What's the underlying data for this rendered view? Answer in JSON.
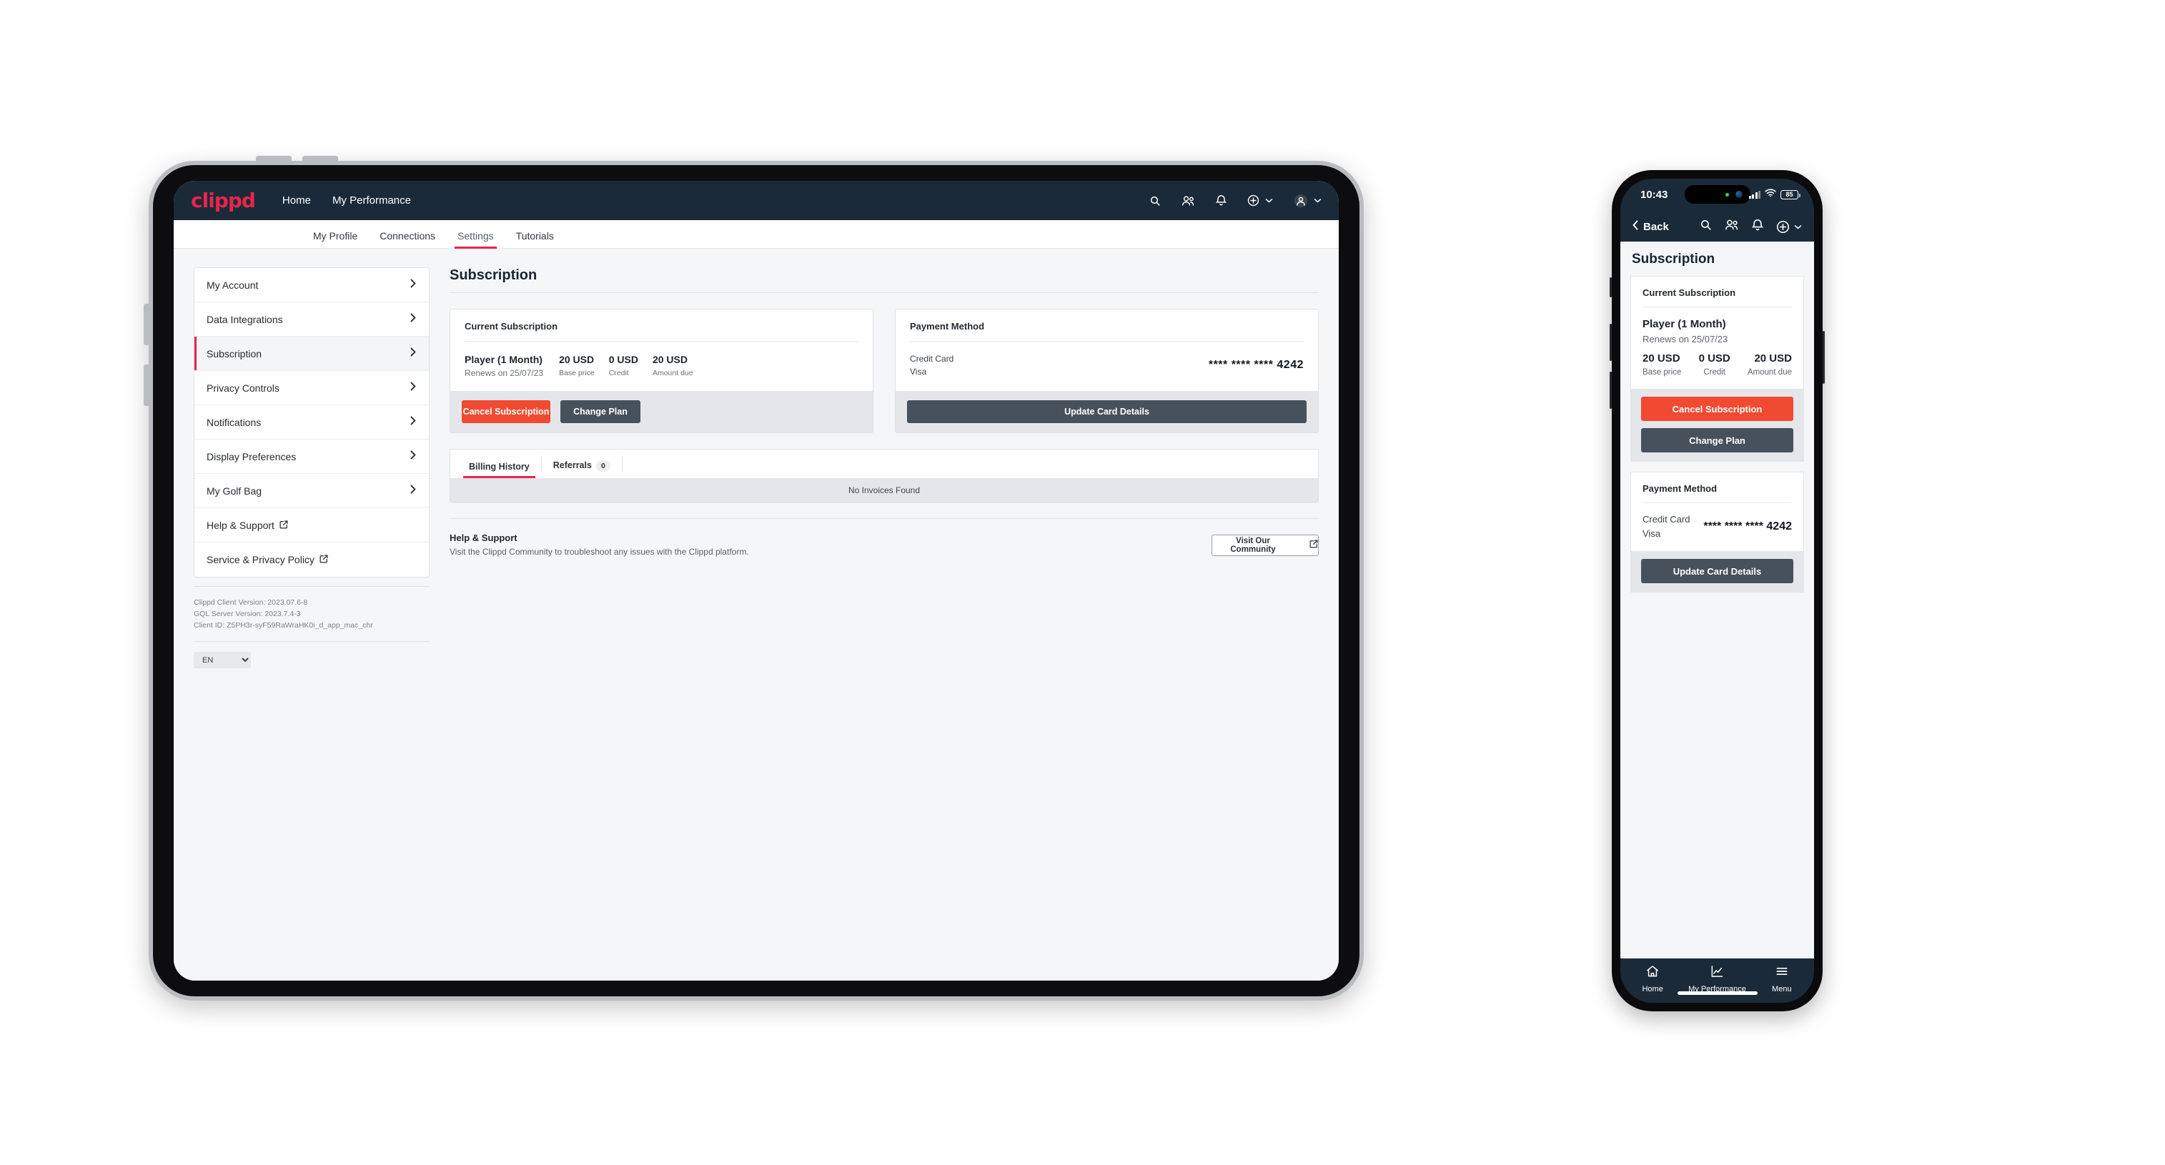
{
  "brand": {
    "name": "clippd",
    "accent": "#e8254b",
    "navbar_bg": "#1b2a38",
    "danger": "#f04a32",
    "dark_button": "#47515c"
  },
  "tablet": {
    "navbar": {
      "logo": "clippd",
      "links": [
        {
          "label": "Home"
        },
        {
          "label": "My Performance"
        }
      ],
      "icons": [
        {
          "name": "search-icon"
        },
        {
          "name": "people-icon"
        },
        {
          "name": "bell-icon"
        },
        {
          "name": "plus-circle-icon"
        },
        {
          "name": "avatar-icon"
        }
      ]
    },
    "tabs": [
      {
        "label": "My Profile",
        "active": false
      },
      {
        "label": "Connections",
        "active": false
      },
      {
        "label": "Settings",
        "active": true
      },
      {
        "label": "Tutorials",
        "active": false
      }
    ],
    "sidebar": {
      "items": [
        {
          "label": "My Account",
          "type": "chevron",
          "selected": false
        },
        {
          "label": "Data Integrations",
          "type": "chevron",
          "selected": false
        },
        {
          "label": "Subscription",
          "type": "chevron",
          "selected": true
        },
        {
          "label": "Privacy Controls",
          "type": "chevron",
          "selected": false
        },
        {
          "label": "Notifications",
          "type": "chevron",
          "selected": false
        },
        {
          "label": "Display Preferences",
          "type": "chevron",
          "selected": false
        },
        {
          "label": "My Golf Bag",
          "type": "chevron",
          "selected": false
        },
        {
          "label": "Help & Support",
          "type": "external",
          "selected": false
        },
        {
          "label": "Service & Privacy Policy",
          "type": "external",
          "selected": false
        }
      ],
      "version": {
        "client_version": "Clippd Client Version: 2023.07.6-8",
        "server_version": "GQL Server Version: 2023.7.4-3",
        "client_id": "Client ID: Z5PH3r-syF59RaWraHK0i_d_app_mac_chr"
      },
      "language": {
        "selected": "EN",
        "options": [
          "EN"
        ]
      }
    },
    "main": {
      "page_title": "Subscription",
      "current_subscription": {
        "heading": "Current Subscription",
        "plan_name": "Player (1 Month)",
        "renews": "Renews on 25/07/23",
        "amounts": [
          {
            "value": "20 USD",
            "label": "Base price"
          },
          {
            "value": "0 USD",
            "label": "Credit"
          },
          {
            "value": "20 USD",
            "label": "Amount due"
          }
        ],
        "cancel_label": "Cancel Subscription",
        "change_label": "Change Plan"
      },
      "payment_method": {
        "heading": "Payment Method",
        "type": "Credit Card",
        "brand": "Visa",
        "card_number": "**** **** **** 4242",
        "update_label": "Update Card Details"
      },
      "history": {
        "tabs": [
          {
            "label": "Billing History",
            "active": true,
            "count": null
          },
          {
            "label": "Referrals",
            "active": false,
            "count": "0"
          }
        ],
        "empty_text": "No Invoices Found"
      },
      "help": {
        "title": "Help & Support",
        "description": "Visit the Clippd Community to troubleshoot any issues with the Clippd platform.",
        "button_label": "Visit Our Community"
      }
    }
  },
  "phone": {
    "status": {
      "time": "10:43",
      "battery": "85"
    },
    "header": {
      "back_label": "Back",
      "icons": [
        {
          "name": "search-icon"
        },
        {
          "name": "people-icon"
        },
        {
          "name": "bell-icon"
        },
        {
          "name": "plus-circle-icon"
        }
      ]
    },
    "page_title": "Subscription",
    "current_subscription": {
      "heading": "Current Subscription",
      "plan_name": "Player (1 Month)",
      "renews": "Renews on 25/07/23",
      "amounts": [
        {
          "value": "20 USD",
          "label": "Base price"
        },
        {
          "value": "0 USD",
          "label": "Credit"
        },
        {
          "value": "20 USD",
          "label": "Amount due"
        }
      ],
      "cancel_label": "Cancel Subscription",
      "change_label": "Change Plan"
    },
    "payment_method": {
      "heading": "Payment Method",
      "type": "Credit Card",
      "brand": "Visa",
      "card_number": "**** **** **** 4242",
      "update_label": "Update Card Details"
    },
    "tabbar": [
      {
        "label": "Home",
        "icon": "home-icon"
      },
      {
        "label": "My Performance",
        "icon": "chart-line-icon"
      },
      {
        "label": "Menu",
        "icon": "hamburger-icon"
      }
    ]
  }
}
